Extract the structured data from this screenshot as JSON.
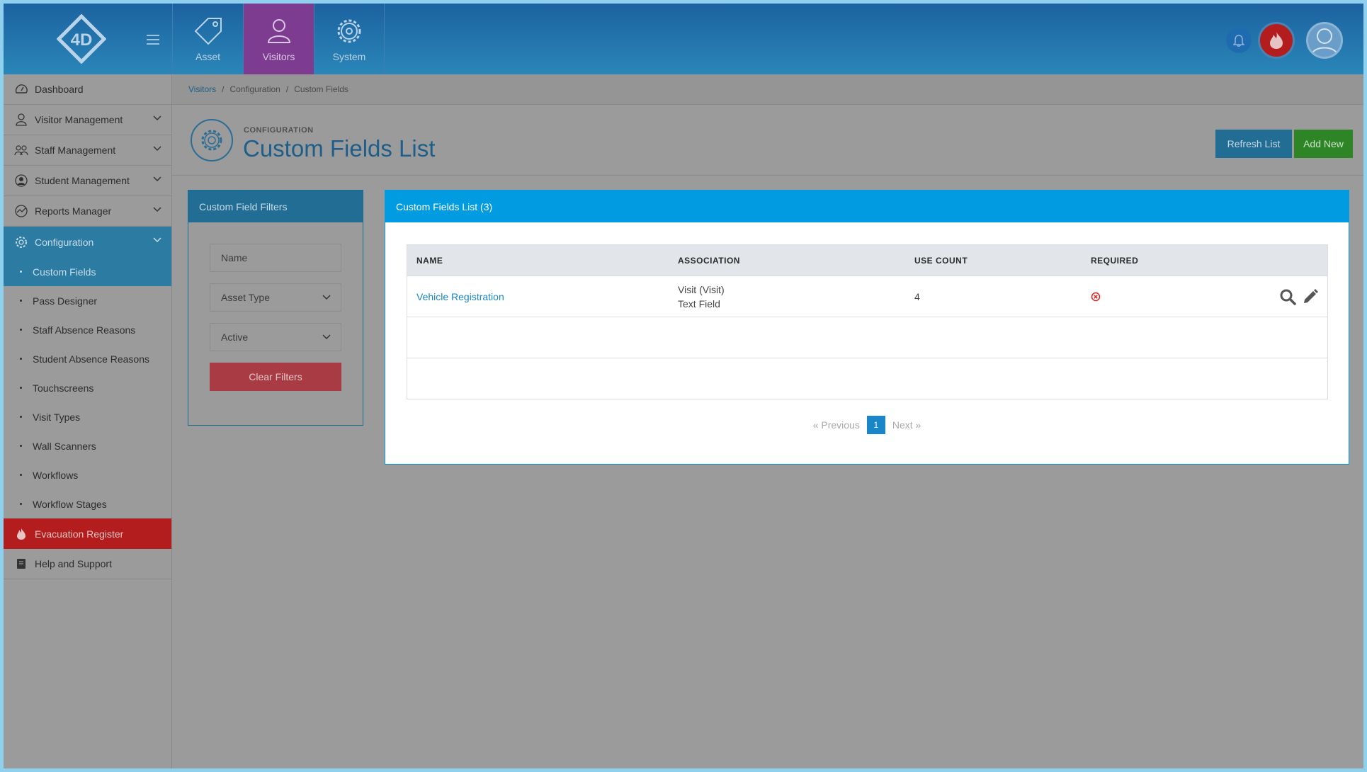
{
  "topbar": {
    "logo_text": "4D",
    "modules": [
      {
        "label": "Asset",
        "icon": "tag-icon",
        "active": false
      },
      {
        "label": "Visitors",
        "icon": "visitor-icon",
        "active": true
      },
      {
        "label": "System",
        "icon": "gear-icon",
        "active": false
      }
    ]
  },
  "sidebar": {
    "items": [
      {
        "label": "Dashboard",
        "icon": "dashboard-icon"
      },
      {
        "label": "Visitor Management",
        "icon": "person-icon"
      },
      {
        "label": "Staff Management",
        "icon": "people-icon"
      },
      {
        "label": "Student Management",
        "icon": "student-icon"
      },
      {
        "label": "Reports Manager",
        "icon": "chart-icon"
      },
      {
        "label": "Configuration",
        "icon": "cog-icon"
      }
    ],
    "config_sub": [
      {
        "label": "Custom Fields",
        "active": true
      },
      {
        "label": "Pass Designer"
      },
      {
        "label": "Staff Absence Reasons"
      },
      {
        "label": "Student Absence Reasons"
      },
      {
        "label": "Touchscreens"
      },
      {
        "label": "Visit Types"
      },
      {
        "label": "Wall Scanners"
      },
      {
        "label": "Workflows"
      },
      {
        "label": "Workflow Stages"
      }
    ],
    "evacuation": "Evacuation Register",
    "help": "Help and Support"
  },
  "breadcrumb": [
    "Visitors",
    "Configuration",
    "Custom Fields"
  ],
  "header": {
    "subtitle": "CONFIGURATION",
    "title": "Custom Fields List",
    "refresh_label": "Refresh List",
    "add_label": "Add New"
  },
  "filters": {
    "title": "Custom Field Filters",
    "name_placeholder": "Name",
    "asset_type": "Asset Type",
    "status": "Active",
    "clear_label": "Clear Filters"
  },
  "list": {
    "title": "Custom Fields List (3)",
    "columns": [
      "NAME",
      "ASSOCIATION",
      "USE COUNT",
      "REQUIRED"
    ],
    "rows": [
      {
        "name": "Vehicle Registration",
        "association": "Visit (Visit)",
        "association_type": "Text Field",
        "use_count": "4",
        "required": "no"
      }
    ],
    "pager": {
      "prev": "Previous",
      "page": "1",
      "next": "Next"
    }
  }
}
